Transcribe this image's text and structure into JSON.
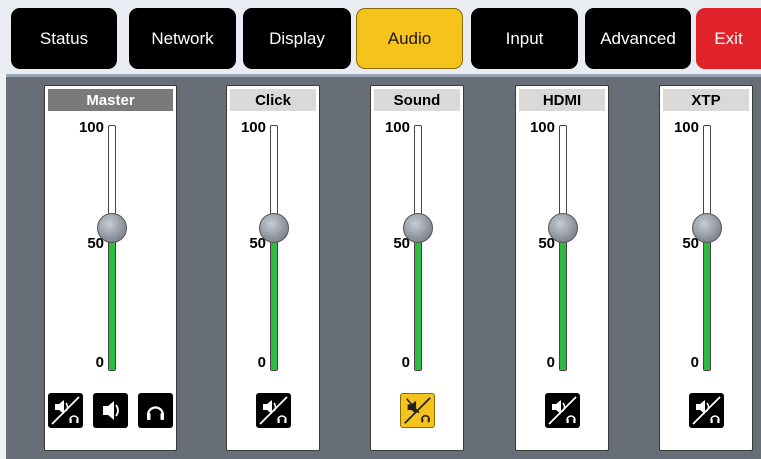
{
  "nav": {
    "tabs": [
      {
        "label": "Status"
      },
      {
        "label": "Network"
      },
      {
        "label": "Display"
      },
      {
        "label": "Audio"
      },
      {
        "label": "Input"
      },
      {
        "label": "Advanced"
      },
      {
        "label": "Exit"
      }
    ],
    "active": "Audio"
  },
  "scale": {
    "max": "100",
    "mid": "50",
    "min": "0"
  },
  "channels": [
    {
      "name": "Master",
      "level": 0.58,
      "buttons": [
        "speaker-headphone-icon",
        "speaker-icon",
        "headphone-icon"
      ],
      "muted": false
    },
    {
      "name": "Click",
      "level": 0.58,
      "buttons": [
        "speaker-headphone-icon"
      ],
      "muted": false
    },
    {
      "name": "Sound",
      "level": 0.58,
      "buttons": [
        "speaker-headphone-muted-icon"
      ],
      "muted": true
    },
    {
      "name": "HDMI",
      "level": 0.58,
      "buttons": [
        "speaker-headphone-icon"
      ],
      "muted": false
    },
    {
      "name": "XTP",
      "level": 0.58,
      "buttons": [
        "speaker-headphone-icon"
      ],
      "muted": false
    }
  ],
  "colors": {
    "active_tab": "#f6c21c",
    "exit": "#e0232b",
    "level_fill": "#2fbb3d",
    "panel_bg": "#686e78"
  }
}
